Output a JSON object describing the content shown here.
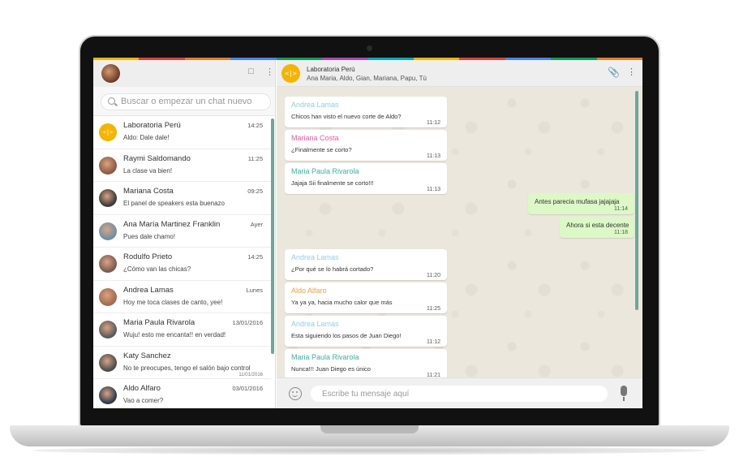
{
  "theme": {
    "rainbow": [
      "#f4b400",
      "#db4437",
      "#e67e22",
      "#4285f4",
      "#0f9d58",
      "#ab47bc",
      "#00acc1",
      "#f4b400",
      "#db4437",
      "#4285f4",
      "#0f9d58",
      "#e67e22"
    ],
    "outgoing_bubble": "#dcf8c6",
    "accent": "#6aa89a"
  },
  "sidebar": {
    "search_placeholder": "Buscar o empezar un chat nuevo",
    "chats": [
      {
        "name": "Laboratoria Perú",
        "time": "14:25",
        "message": "Aldo: Dale dale!",
        "avatar": "laboratoria-logo"
      },
      {
        "name": "Raymi Saldomando",
        "time": "11:25",
        "message": "La clase va bien!",
        "avatar": "photo"
      },
      {
        "name": "Mariana Costa",
        "time": "09:25",
        "message": "El panel de speakers esta buenazo",
        "avatar": "photo"
      },
      {
        "name": "Ana María Martinez Franklin",
        "time": "Ayer",
        "message": "Pues dale chamo!",
        "avatar": "photo"
      },
      {
        "name": "Rodulfo Prieto",
        "time": "14:25",
        "message": "¿Cómo van las chicas?",
        "avatar": "photo"
      },
      {
        "name": "Andrea Lamas",
        "time": "Lunes",
        "message": "Hoy me toca clases de canto, yee!",
        "avatar": "photo"
      },
      {
        "name": "Maria Paula Rivarola",
        "time": "13/01/2016",
        "message": "Wuju! esto me encanta!! en verdad!",
        "avatar": "photo"
      },
      {
        "name": "Katy Sanchez",
        "time": "11/01/2016",
        "message": "No te preocupes, tengo el salón bajo control",
        "avatar": "photo"
      },
      {
        "name": "Aldo Alfaro",
        "time": "03/01/2016",
        "message": "Vao a comer?",
        "avatar": "photo"
      }
    ]
  },
  "conversation": {
    "group_avatar_text": "<|>",
    "title": "Laboratoria Perú",
    "members": "Ana Maria, Aldo, Gian, Mariana, Papu, Tú",
    "messages": [
      {
        "direction": "in",
        "sender": "Andrea Lamas",
        "color": "#8ecfe8",
        "text": "Chicos han visto el nuevo corte de Aldo?",
        "time": "11:12"
      },
      {
        "direction": "in",
        "sender": "Mariana Costa",
        "color": "#e65aa0",
        "text": "¿Finalmente se corto?",
        "time": "11:13"
      },
      {
        "direction": "in",
        "sender": "Maria Paula Rivarola",
        "color": "#3ab09e",
        "text": "Jajaja Sii finalmente se corto!!!",
        "time": "11:13"
      },
      {
        "direction": "out",
        "text": "Antes parecia mufasa jajajaja",
        "time": "11:14"
      },
      {
        "direction": "out",
        "text": "Ahora si esta decente",
        "time": "11:18"
      },
      {
        "direction": "in",
        "sender": "Andrea Lamas",
        "color": "#8ecfe8",
        "text": "¿Por qué se lo habrá cortado?",
        "time": "11:20"
      },
      {
        "direction": "in",
        "sender": "Aldo Alfaro",
        "color": "#f0a040",
        "text": "Ya ya ya, hacia mucho calor que más",
        "time": "11:25"
      },
      {
        "direction": "in",
        "sender": "Andrea Lamas",
        "color": "#8ecfe8",
        "text": "Esta siguiendo los pasos de Juan Diego!",
        "time": "11:12"
      },
      {
        "direction": "in",
        "sender": "Maria Paula Rivarola",
        "color": "#3ab09e",
        "text": "Nunca!!! Juan Diego es único",
        "time": "11:21"
      }
    ],
    "input_placeholder": "Escribe tu mensaje aquí"
  }
}
